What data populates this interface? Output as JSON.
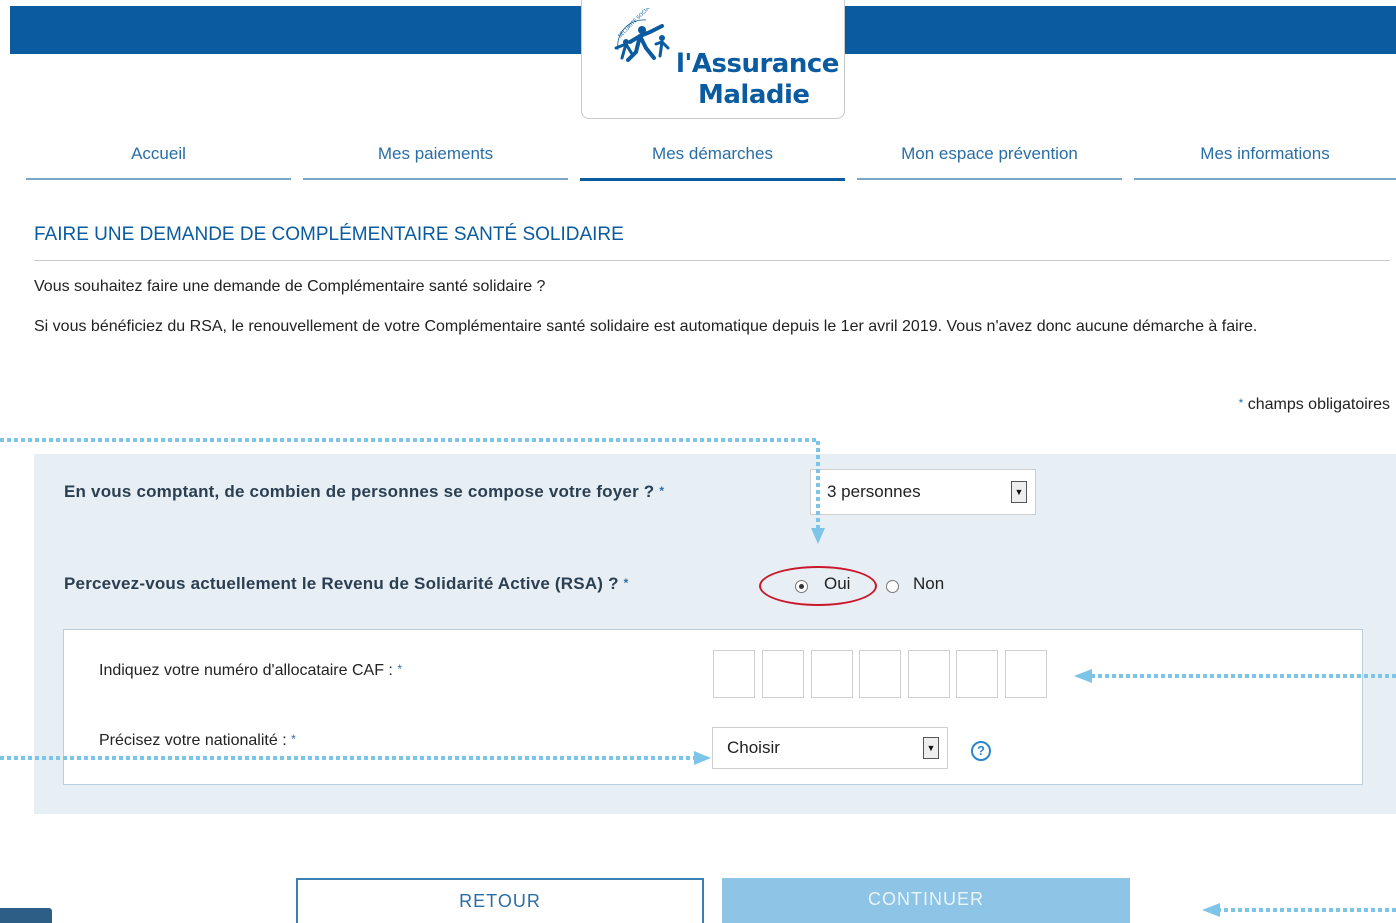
{
  "header": {
    "logo_line1": "l'Assurance",
    "logo_line2": "Maladie",
    "logo_arc_text": "SÉCURITÉ SOCIALE"
  },
  "nav": {
    "items": [
      {
        "label": "Accueil"
      },
      {
        "label": "Mes paiements"
      },
      {
        "label": "Mes démarches"
      },
      {
        "label": "Mon espace prévention"
      },
      {
        "label": "Mes informations"
      }
    ],
    "active_index": 2
  },
  "page": {
    "title": "FAIRE UNE DEMANDE DE COMPLÉMENTAIRE SANTÉ SOLIDAIRE",
    "intro_question": "Vous souhaitez faire une demande de Complémentaire santé solidaire ?",
    "intro_rsa": "Si vous bénéficiez du RSA, le renouvellement de votre Complémentaire santé solidaire est automatique depuis le 1er avril 2019. Vous n'avez donc aucune démarche à faire.",
    "required_star": "*",
    "required_note": "champs obligatoires"
  },
  "form": {
    "household_question": "En vous comptant, de combien de personnes se compose votre foyer ?",
    "household_value": "3 personnes",
    "rsa_question": "Percevez-vous actuellement le Revenu de Solidarité Active (RSA) ?",
    "rsa_options": [
      {
        "label": "Oui",
        "checked": true
      },
      {
        "label": "Non",
        "checked": false
      }
    ],
    "caf_label": "Indiquez votre numéro d'allocataire CAF :",
    "caf_digits": [
      "",
      "",
      "",
      "",
      "",
      "",
      ""
    ],
    "nationality_label": "Précisez votre nationalité :",
    "nationality_value": "Choisir",
    "help_symbol": "?"
  },
  "buttons": {
    "retour": "RETOUR",
    "continuer": "CONTINUER"
  },
  "colors": {
    "brand_blue": "#0a5ba0",
    "link_blue": "#2a6ea6",
    "panel_bg": "#e7eef4",
    "continue_bg": "#8ec4e6",
    "annotation_red": "#c9182b",
    "annotation_arrow": "#7cc4e8"
  }
}
